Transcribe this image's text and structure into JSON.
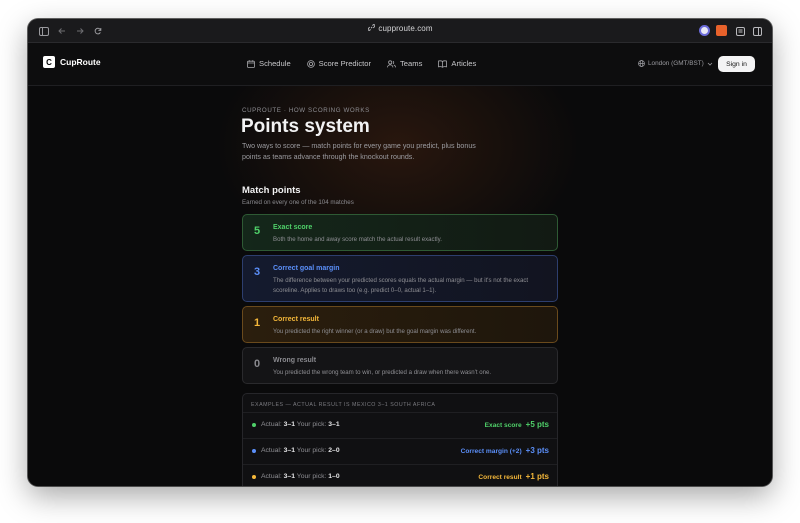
{
  "browser": {
    "url": "cupproute.com"
  },
  "header": {
    "logo_letter": "C",
    "logo_text": "CupRoute",
    "nav": [
      {
        "label": "Schedule",
        "icon": "calendar-icon"
      },
      {
        "label": "Score Predictor",
        "icon": "target-icon"
      },
      {
        "label": "Teams",
        "icon": "users-icon"
      },
      {
        "label": "Articles",
        "icon": "book-icon"
      }
    ],
    "timezone": "London (GMT/BST)",
    "signin_label": "Sign in"
  },
  "page": {
    "eyebrow": "CUPROUTE · HOW SCORING WORKS",
    "title": "Points system",
    "intro": "Two ways to score — match points for every game you predict, plus bonus points as teams advance through the knockout rounds."
  },
  "match_points": {
    "title": "Match points",
    "subtitle": "Earned on every one of the 104 matches",
    "cards": [
      {
        "points": "5",
        "title": "Exact score",
        "desc": "Both the home and away score match the actual result exactly.",
        "color": "#4fd069"
      },
      {
        "points": "3",
        "title": "Correct goal margin",
        "desc": "The difference between your predicted scores equals the actual margin — but it's not the exact scoreline. Applies to draws too (e.g. predict 0–0, actual 1–1).",
        "color": "#5b8ff9"
      },
      {
        "points": "1",
        "title": "Correct result",
        "desc": "You predicted the right winner (or a draw) but the goal margin was different.",
        "color": "#f5b83a"
      },
      {
        "points": "0",
        "title": "Wrong result",
        "desc": "You predicted the wrong team to win, or predicted a draw when there wasn't one.",
        "color": "#8a8a8f"
      }
    ]
  },
  "examples": {
    "heading": "EXAMPLES — ACTUAL RESULT IS MEXICO 3–1 SOUTH AFRICA",
    "rows": [
      {
        "actual_label": "Actual:",
        "actual": "3–1",
        "pick_label": "Your pick:",
        "pick": "3–1",
        "result": "Exact score",
        "pts": "+5 pts",
        "color": "#4fd069"
      },
      {
        "actual_label": "Actual:",
        "actual": "3–1",
        "pick_label": "Your pick:",
        "pick": "2–0",
        "result": "Correct margin (+2)",
        "pts": "+3 pts",
        "color": "#5b8ff9"
      },
      {
        "actual_label": "Actual:",
        "actual": "3–1",
        "pick_label": "Your pick:",
        "pick": "1–0",
        "result": "Correct result",
        "pts": "+1 pts",
        "color": "#f5b83a"
      }
    ]
  }
}
